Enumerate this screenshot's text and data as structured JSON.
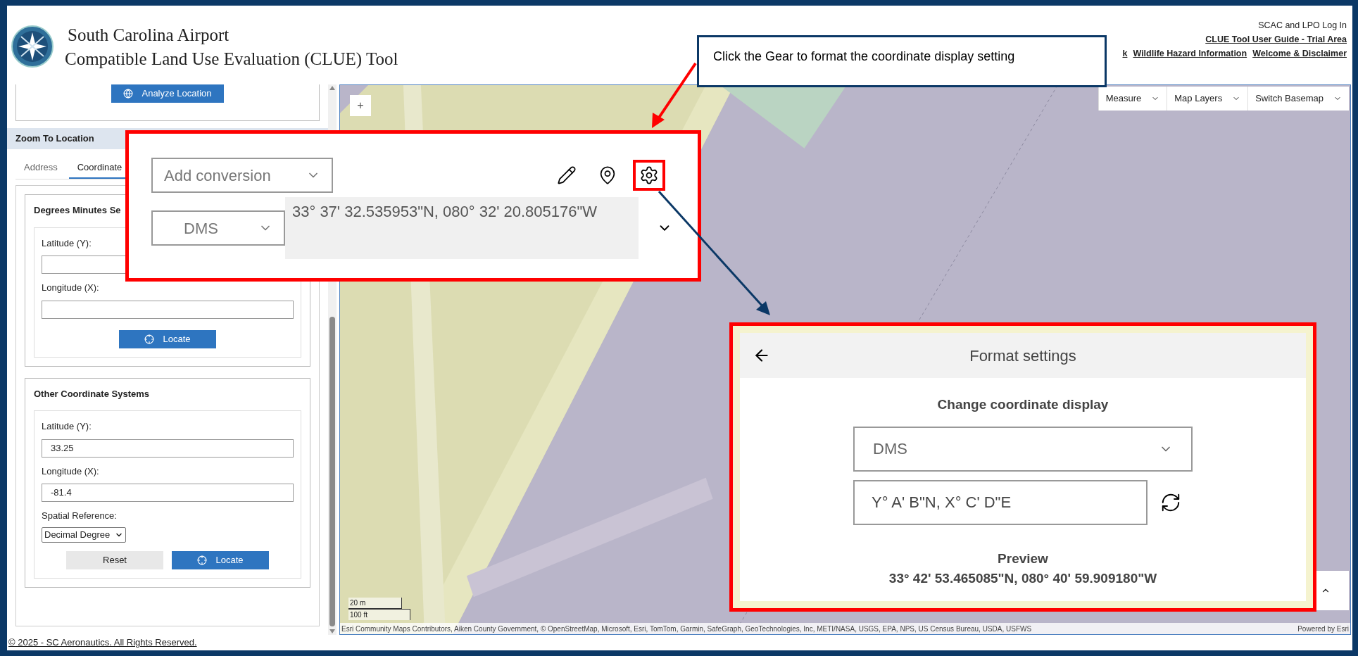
{
  "header": {
    "title_lines": [
      "South Carolina Airport",
      "Compatible Land Use Evaluation (CLUE) Tool"
    ],
    "login": "SCAC and LPO Log In",
    "guide_link": "CLUE Tool User Guide - Trial Area",
    "links": [
      "k",
      "Wildlife Hazard Information",
      "Welcome & Disclaimer"
    ]
  },
  "callout": {
    "text": "Click the Gear to format the coordinate display setting"
  },
  "sidebar": {
    "analyze_button": "Analyze Location",
    "section_title": "Zoom To Location",
    "tabs": [
      {
        "label": "Address",
        "selected": false
      },
      {
        "label": "Coordinate",
        "selected": true
      }
    ],
    "dms_group": {
      "title": "Degrees Minutes Se",
      "fields": [
        {
          "label": "Latitude (Y):"
        },
        {
          "label": "Longitude (X):"
        }
      ],
      "locate_button": "Locate"
    },
    "other_group": {
      "title": "Other Coordinate Systems",
      "fields": [
        {
          "label": "Latitude (Y):",
          "value": "33.25"
        },
        {
          "label": "Longitude (X):",
          "value": "-81.4"
        }
      ],
      "spatial_reference": {
        "label": "Spatial Reference:",
        "value": "Decimal Degree"
      },
      "reset_button": "Reset",
      "locate_button": "Locate"
    }
  },
  "map": {
    "zoom_in": "+",
    "toolbar": [
      "Measure",
      "Map Layers",
      "Switch Basemap"
    ],
    "scale": [
      "20 m",
      "100 ft"
    ],
    "attribution": "Esri Community Maps Contributors, Aiken County Government, © OpenStreetMap, Microsoft, Esri, TomTom, Garmin, SafeGraph, GeoTechnologies, Inc, METI/NASA, USGS, EPA, NPS, US Census Bureau, USDA, USFWS",
    "powered_by": "Powered by Esri"
  },
  "coordinate_widget": {
    "add_conversion": "Add conversion",
    "format": "DMS",
    "coordinate": "33° 37' 32.535953\"N, 080° 32' 20.805176\"W"
  },
  "format_settings": {
    "title": "Format settings",
    "subtitle": "Change coordinate display",
    "format": "DMS",
    "pattern": "Y° A' B\"N, X° C' D\"E",
    "preview_label": "Preview",
    "preview": "33° 42' 53.465085\"N, 080° 40' 59.909180\"W"
  },
  "footer": "© 2025 - SC Aeronautics. All Rights Reserved."
}
